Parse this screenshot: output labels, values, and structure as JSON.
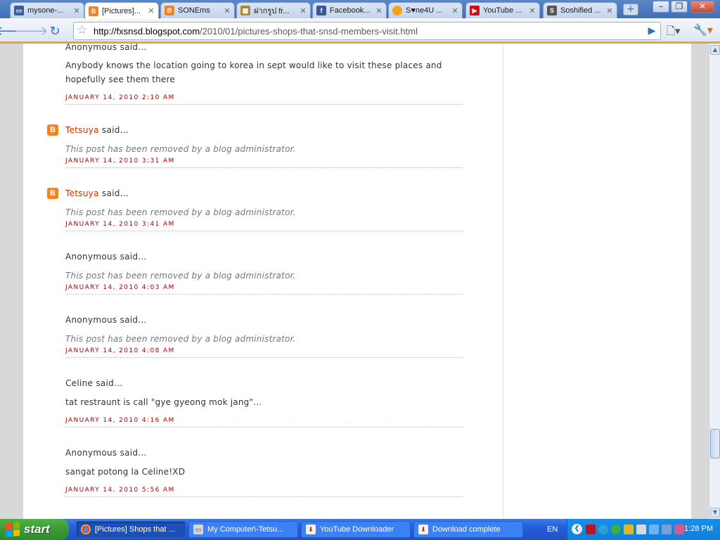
{
  "browser": {
    "tabs": [
      {
        "title": "mysone-...",
        "icon": "mysone-favicon",
        "active": false
      },
      {
        "title": "[Pictures]...",
        "icon": "blogger-favicon",
        "active": true
      },
      {
        "title": "SONEms",
        "icon": "blogger-favicon",
        "active": false
      },
      {
        "title": "ฝากรูป fr...",
        "icon": "image-host-favicon",
        "active": false
      },
      {
        "title": "Facebook...",
        "icon": "facebook-favicon",
        "active": false
      },
      {
        "title": "S♥ne4U ...",
        "icon": "sone4u-favicon",
        "active": false
      },
      {
        "title": "YouTube ...",
        "icon": "youtube-favicon",
        "active": false
      },
      {
        "title": "Soshified ...",
        "icon": "soshified-favicon",
        "active": false
      }
    ],
    "url_domain": "http://fxsnsd.blogspot.com",
    "url_path": "/2010/01/pictures-shops-that-snsd-members-visit.html"
  },
  "comments": [
    {
      "author": "Anonymous",
      "said": " said...",
      "linked": false,
      "removed": false,
      "body": "Anybody knows the location going to korea in sept would like to visit these places and hopefully see them there",
      "time": "January 14, 2010 2:10 AM"
    },
    {
      "author": "Tetsuya",
      "said": " said...",
      "linked": true,
      "removed": true,
      "body": "This post has been removed by a blog administrator.",
      "time": "January 14, 2010 3:31 AM"
    },
    {
      "author": "Tetsuya",
      "said": " said...",
      "linked": true,
      "removed": true,
      "body": "This post has been removed by a blog administrator.",
      "time": "January 14, 2010 3:41 AM"
    },
    {
      "author": "Anonymous",
      "said": " said...",
      "linked": false,
      "removed": true,
      "body": "This post has been removed by a blog administrator.",
      "time": "January 14, 2010 4:03 AM"
    },
    {
      "author": "Anonymous",
      "said": " said...",
      "linked": false,
      "removed": true,
      "body": "This post has been removed by a blog administrator.",
      "time": "January 14, 2010 4:08 AM"
    },
    {
      "author": "Celine",
      "said": " said...",
      "linked": false,
      "removed": false,
      "body": "tat restraunt is call \"gye gyeong mok jang\"...",
      "time": "January 14, 2010 4:16 AM"
    },
    {
      "author": "Anonymous",
      "said": " said...",
      "linked": false,
      "removed": false,
      "body": "sangat potong la Celine!XD",
      "time": "January 14, 2010 5:56 AM"
    }
  ],
  "taskbar": {
    "start_label": "start",
    "tasks": [
      {
        "title": "[Pictures] Shops that ...",
        "icon": "chrome-icon",
        "active": true
      },
      {
        "title": "My Computer\\-Tetsu...",
        "icon": "drive-icon",
        "active": false
      },
      {
        "title": "YouTube Downloader",
        "icon": "download-icon",
        "active": false
      },
      {
        "title": "Download complete",
        "icon": "download-icon",
        "active": false
      }
    ],
    "language": "EN",
    "clock": "1:28 PM"
  },
  "colors": {
    "toolbar_accent": "#e9a53a",
    "comment_author_link": "#cc3300",
    "timestamp": "#aa0000",
    "taskbar_blue": "#245edb",
    "start_green": "#3a9a34"
  }
}
